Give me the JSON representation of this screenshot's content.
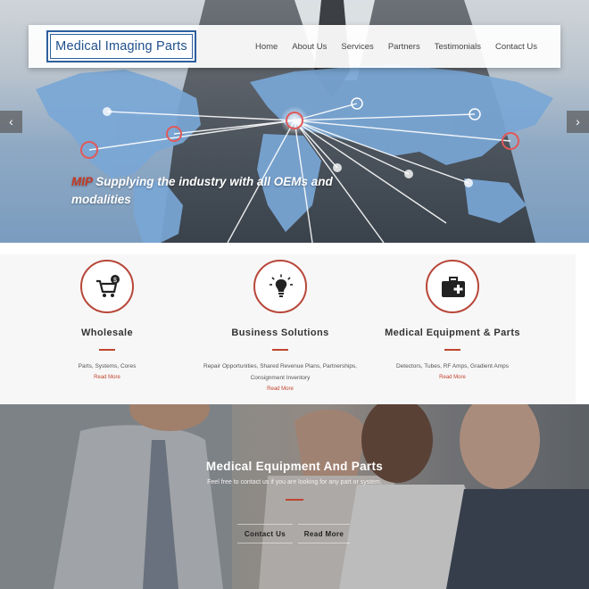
{
  "header": {
    "logo_text": "Medical Imaging Parts",
    "nav": [
      "Home",
      "About Us",
      "Services",
      "Partners",
      "Testimonials",
      "Contact Us"
    ]
  },
  "hero": {
    "caption_brand": "MIP",
    "caption_text": " Supplying the industry with all OEMs and modalities",
    "prev_arrow": "‹",
    "next_arrow": "›"
  },
  "services": [
    {
      "icon": "shopping-cart-icon",
      "title": "Wholesale",
      "description": "Parts, Systems, Cores",
      "link": "Read More"
    },
    {
      "icon": "lightbulb-icon",
      "title": "Business Solutions",
      "description": "Repair Opportunities, Shared Revenue Plans, Partnerships, Consignment Inventory",
      "link": "Read More"
    },
    {
      "icon": "first-aid-kit-icon",
      "title": "Medical Equipment & Parts",
      "description": "Detectors, Tubes, RF Amps, Gradient Amps",
      "link": "Read More"
    }
  ],
  "banner": {
    "title": "Medical Equipment And Parts",
    "subtitle": "Feel free to contact us if you are looking for any part or system.",
    "buttons": [
      "Contact Us",
      "Read More"
    ]
  },
  "colors": {
    "accent": "#c1452f",
    "logo_blue": "#1e4f8d",
    "map_blue": "#6e9ccf"
  }
}
